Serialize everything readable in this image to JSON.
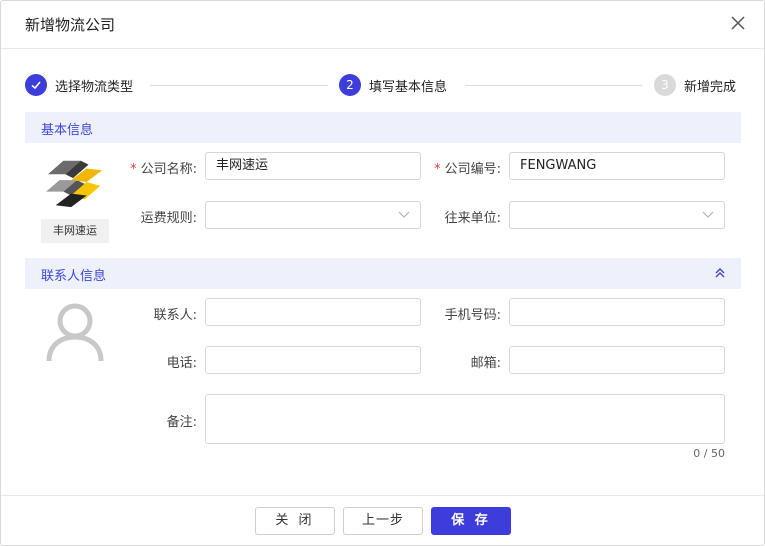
{
  "dialog": {
    "title": "新增物流公司"
  },
  "steps": [
    {
      "number": "✓",
      "label": "选择物流类型",
      "state": "done"
    },
    {
      "number": "2",
      "label": "填写基本信息",
      "state": "active"
    },
    {
      "number": "3",
      "label": "新增完成",
      "state": "pending"
    }
  ],
  "basic_info": {
    "section_title": "基本信息",
    "logo_caption": "丰网速运",
    "company_name_label": "公司名称:",
    "company_name_value": "丰网速运",
    "company_code_label": "公司编号:",
    "company_code_value": "FENGWANG",
    "freight_rule_label": "运费规则:",
    "freight_rule_value": "",
    "partner_label": "往来单位:",
    "partner_value": ""
  },
  "contact_info": {
    "section_title": "联系人信息",
    "contact_label": "联系人:",
    "contact_value": "",
    "mobile_label": "手机号码:",
    "mobile_value": "",
    "phone_label": "电话:",
    "phone_value": "",
    "email_label": "邮箱:",
    "email_value": "",
    "remark_label": "备注:",
    "remark_value": "",
    "remark_counter": "0 / 50"
  },
  "footer": {
    "close_label": "关 闭",
    "prev_label": "上一步",
    "save_label": "保 存"
  },
  "colors": {
    "accent": "#3d3ddb",
    "section_bg": "#eef0fc",
    "required": "#e03b3b",
    "step_pending": "#d9d9d9"
  }
}
